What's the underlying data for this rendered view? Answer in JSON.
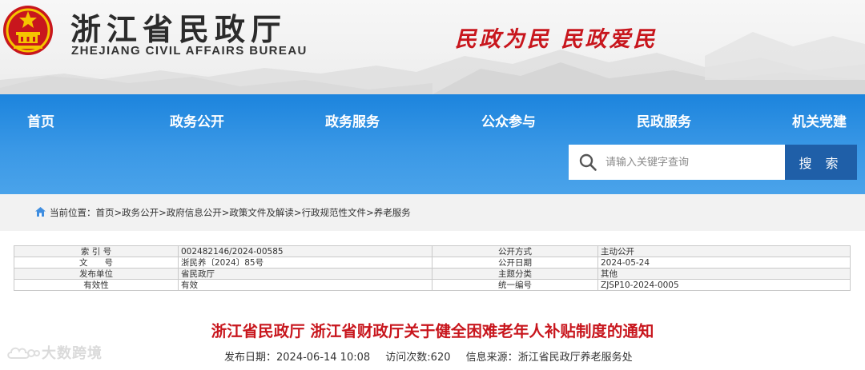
{
  "header": {
    "title": "浙江省民政厅",
    "subtitle": "ZHEJIANG CIVIL AFFAIRS BUREAU",
    "slogan": "民政为民  民政爱民",
    "emblem_icon": "national-emblem-icon",
    "colors": {
      "slogan": "#c8161d",
      "title": "#2b2b2b"
    }
  },
  "nav": {
    "items": [
      {
        "label": "首页"
      },
      {
        "label": "政务公开"
      },
      {
        "label": "政务服务"
      },
      {
        "label": "公众参与"
      },
      {
        "label": "民政服务"
      },
      {
        "label": "机关党建"
      }
    ],
    "colors": {
      "band": "#2a8de2",
      "search_button": "#1f5fa8"
    }
  },
  "search": {
    "placeholder": "请输入关键字查询",
    "button_label": "搜 索",
    "icon": "search-icon"
  },
  "breadcrumb": {
    "prefix": "当前位置：",
    "items": [
      "首页",
      "政务公开",
      "政府信息公开",
      "政策文件及解读",
      "行政规范性文件",
      "养老服务"
    ],
    "separator": ">",
    "icon": "home-icon"
  },
  "info_table": {
    "rows": [
      {
        "label1": "索 引 号",
        "value1": "002482146/2024-00585",
        "label2": "公开方式",
        "value2": "主动公开"
      },
      {
        "label1": "文　　号",
        "value1": "浙民养〔2024〕85号",
        "label2": "公开日期",
        "value2": "2024-05-24"
      },
      {
        "label1": "发布单位",
        "value1": "省民政厅",
        "label2": "主题分类",
        "value2": "其他"
      },
      {
        "label1": "有效性",
        "value1": "有效",
        "label2": "统一编号",
        "value2": "ZJSP10-2024-0005"
      }
    ]
  },
  "article": {
    "title": "浙江省民政厅 浙江省财政厅关于健全困难老年人补贴制度的通知",
    "publish_date": "发布日期：2024-06-14 10:08",
    "visits": "访问次数:620",
    "source": "信息来源：浙江省民政厅养老服务处",
    "colors": {
      "title": "#c8161d"
    }
  },
  "watermark": {
    "text": "大数跨境",
    "icon": "cloud-logo-icon"
  }
}
